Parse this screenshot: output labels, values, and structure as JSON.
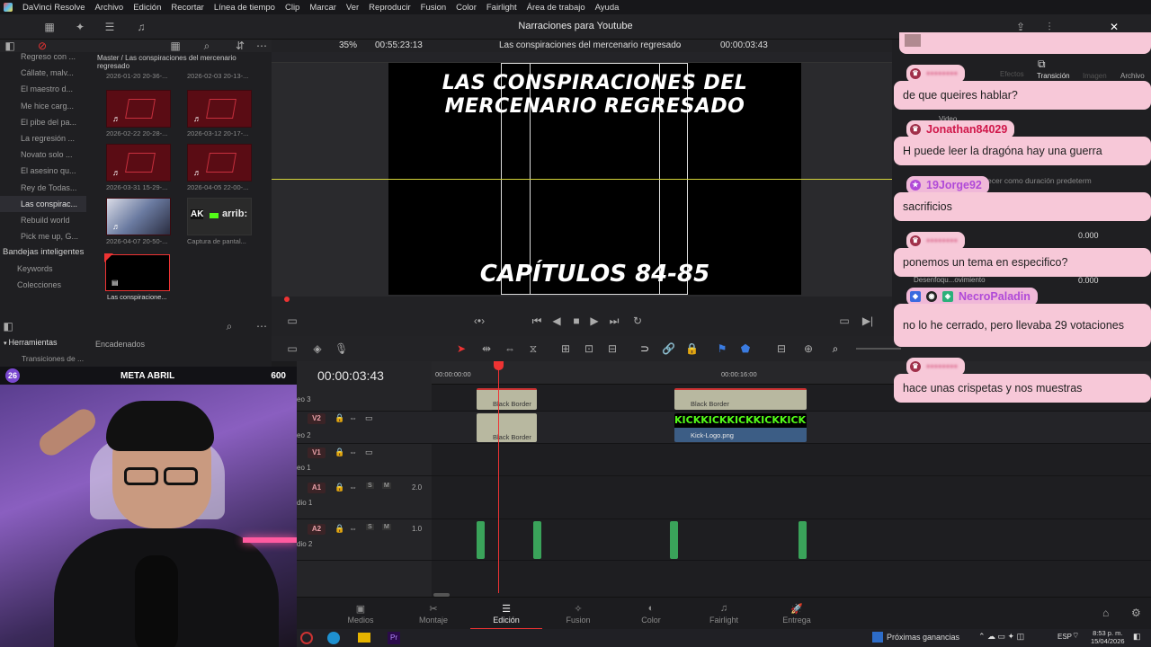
{
  "menubar": {
    "app": "DaVinci Resolve",
    "items": [
      "Archivo",
      "Edición",
      "Recortar",
      "Línea de tiempo",
      "Clip",
      "Marcar",
      "Ver",
      "Reproducir",
      "Fusion",
      "Color",
      "Fairlight",
      "Área de trabajo",
      "Ayuda"
    ]
  },
  "toolbar": {
    "project_title": "Narraciones para Youtube"
  },
  "viewer": {
    "zoom": "35%",
    "source_timecode": "00:55:23:13",
    "timeline_name": "Las conspiraciones del mercenario regresado",
    "record_timecode": "00:00:03:43",
    "video_title": "LAS CONSPIRACIONES DEL MERCENARIO REGRESADO",
    "chapters": "CAPÍTULOS 84-85"
  },
  "bins": {
    "items": [
      "Regreso con ...",
      "Cállate, malv...",
      "El maestro d...",
      "Me hice carg...",
      "El pibe del pa...",
      "La regresión ...",
      "Novato solo ...",
      "El asesino qu...",
      "Rey de Todas...",
      "Las conspirac...",
      "Rebuild world",
      "Pick me up, G..."
    ],
    "active_index": 9
  },
  "smart_bins": {
    "title": "Bandejas inteligentes",
    "items": [
      "Keywords",
      "Colecciones"
    ]
  },
  "media_pool": {
    "path": "Master / Las conspiraciones del mercenario regresado",
    "clips": [
      {
        "label": "2026-01-20 20-36-..."
      },
      {
        "label": "2026-02-03 20-13-..."
      },
      {
        "label": "2026-02-22 20-28-..."
      },
      {
        "label": "2026-03-12 20-17-..."
      },
      {
        "label": "2026-03-31 15-29-..."
      },
      {
        "label": "2026-04-05 22-00-..."
      },
      {
        "label": "2026-04-07 20-50-..."
      },
      {
        "label": "Captura de pantal..."
      },
      {
        "label": "Las conspiracione..."
      }
    ],
    "capture_thumb_text": "arrib:"
  },
  "effects_panel": {
    "tab_herramientas": "Herramientas",
    "tab_encadenados": "Encadenados",
    "item1": "Transiciones de ...",
    "item2": "Transiciones de ..."
  },
  "inspector": {
    "tabs": [
      "Efectos",
      "Transición",
      "Imagen",
      "Archivo"
    ],
    "video_label": "Video",
    "duration_hint": "ecer como duración predeterm",
    "blur_label": "Desenfoqu...ovimiento",
    "value1": "0.000",
    "value2": "0.000"
  },
  "timeline": {
    "timecode": "00:00:03:43",
    "ruler_start": "00:00:00:00",
    "ruler_mid": "00:00:16:00",
    "tracks": [
      {
        "tag": "V2",
        "name": "eo 2"
      },
      {
        "tag": "V1",
        "name": "eo 1"
      },
      {
        "tag": "A1",
        "name": "dio 1",
        "level": "2.0"
      },
      {
        "tag": "A2",
        "name": "dio 2",
        "level": "1.0"
      }
    ],
    "track3_name": "eo 3",
    "clip_black_border": "Black Border",
    "clip_kick_logo": "Kick-Logo.png",
    "kick_text": "KICKKICKKICKKICKKICKKICK"
  },
  "pages": {
    "items": [
      "Medios",
      "Montaje",
      "Edición",
      "Fusion",
      "Color",
      "Fairlight",
      "Entrega"
    ],
    "active_index": 2
  },
  "taskbar": {
    "news": "Próximas ganancias",
    "lang": "ESP",
    "time": "8:53 p. m.",
    "date": "15/04/2026"
  },
  "stream_goal": {
    "count": "26",
    "label": "META ABRIL",
    "value": "600"
  },
  "chat": [
    {
      "user": "",
      "message": "de que queires hablar?"
    },
    {
      "user": "Jonathan84029",
      "message": "H puede leer la dragóna hay una guerra"
    },
    {
      "user": "19Jorge92",
      "message": "sacrificios"
    },
    {
      "user": "",
      "message": "ponemos un tema en especifico?"
    },
    {
      "user": "NecroPaladin",
      "message": "no lo he cerrado, pero llevaba 29 votaciones"
    },
    {
      "user": "",
      "message": "hace unas crispetas y nos muestras"
    }
  ],
  "colors": {
    "accent_red": "#e33333",
    "chat_bg": "#f7c8d8",
    "user_red": "#d0174a",
    "user_purple": "#b04ad8"
  }
}
